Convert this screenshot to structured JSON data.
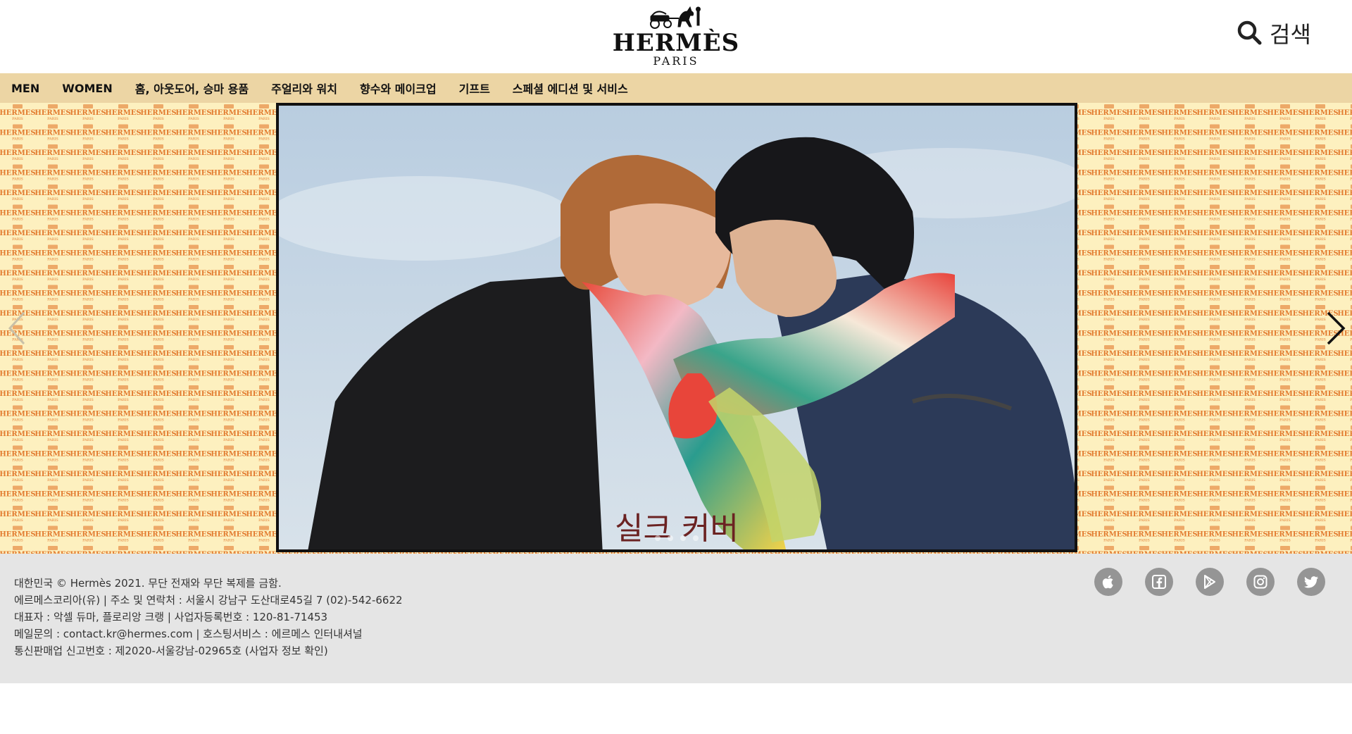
{
  "header": {
    "logo_word": "HERMÈS",
    "logo_sub": "PARIS",
    "search_label": "검색"
  },
  "nav": {
    "items": [
      {
        "label": "MEN"
      },
      {
        "label": "WOMEN"
      },
      {
        "label": "홈, 아웃도어, 승마 용품"
      },
      {
        "label": "주얼리와 워치"
      },
      {
        "label": "향수와 메이크업"
      },
      {
        "label": "기프트"
      },
      {
        "label": "스페셜 에디션 및 서비스"
      }
    ]
  },
  "hero": {
    "caption": "실크 커버",
    "pattern_word": "HERMES",
    "pattern_sub": "PARIS",
    "background_color": "#fdf0bf",
    "pattern_color": "#e27a2e"
  },
  "footer": {
    "lines": [
      "대한민국 © Hermès 2021. 무단 전재와 무단 복제를 금함.",
      "에르메스코리아(유) | 주소 및 연락처 : 서울시 강남구 도산대로45길 7 (02)-542-6622",
      "대표자 : 악셀 듀마, 플로리앙 크랭  | 사업자등록번호 : 120-81-71453",
      "메일문의 : contact.kr@hermes.com  | 호스팅서비스 : 에르메스 인터내셔널",
      "통신판매업 신고번호 : 제2020-서울강남-02965호 (사업자 정보 확인)"
    ],
    "social": [
      {
        "icon": "apple-icon"
      },
      {
        "icon": "facebook-icon"
      },
      {
        "icon": "google-play-icon"
      },
      {
        "icon": "instagram-icon"
      },
      {
        "icon": "twitter-icon"
      }
    ]
  },
  "colors": {
    "nav_bg": "#ecd5a4",
    "footer_bg": "#e5e5e5",
    "social_icon_bg": "#959595"
  }
}
